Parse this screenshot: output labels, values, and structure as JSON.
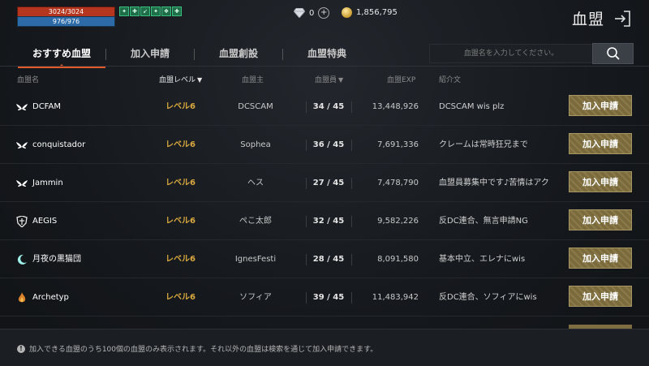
{
  "status": {
    "hp_text": "3024/3024",
    "mp_text": "976/976",
    "hp_fill": 1.0,
    "mp_fill": 1.0,
    "buff_icons": [
      "buff-icon",
      "buff-icon",
      "buff-icon",
      "buff-icon",
      "buff-icon",
      "buff-icon"
    ]
  },
  "currency": {
    "diamonds": "0",
    "gold": "1,856,795"
  },
  "header": {
    "title": "血盟"
  },
  "tabs": [
    {
      "label": "おすすめ血盟",
      "active": true
    },
    {
      "label": "加入申請",
      "active": false
    },
    {
      "label": "血盟創設",
      "active": false
    },
    {
      "label": "血盟特典",
      "active": false
    }
  ],
  "search": {
    "placeholder": "血盟名を入力してください。"
  },
  "columns": {
    "name": "血盟名",
    "level": "血盟レベル",
    "master": "血盟主",
    "members": "血盟員",
    "exp": "血盟EXP",
    "intro": "紹介文"
  },
  "clans": [
    {
      "emblem": "wings-emblem-icon",
      "name": "DCFAM",
      "level": "レベル6",
      "master": "DCSCAM",
      "members": "34 / 45",
      "exp": "13,448,926",
      "intro": "DCSCAM wis plz",
      "join": "加入申請"
    },
    {
      "emblem": "wings-emblem-icon",
      "name": "conquistador",
      "level": "レベル6",
      "master": "Sophea",
      "members": "36 / 45",
      "exp": "7,691,336",
      "intro": "クレームは常時狂兄まで",
      "join": "加入申請"
    },
    {
      "emblem": "wings-emblem-icon",
      "name": "Jammin",
      "level": "レベル6",
      "master": "ヘス",
      "members": "27 / 45",
      "exp": "7,478,790",
      "intro": "血盟員募集中です♪苦情はアク",
      "join": "加入申請"
    },
    {
      "emblem": "shield-emblem-icon",
      "name": "AEGIS",
      "level": "レベル6",
      "master": "ぺこ太郎",
      "members": "32 / 45",
      "exp": "9,582,226",
      "intro": "反DC連合、無言申請NG",
      "join": "加入申請"
    },
    {
      "emblem": "crescent-emblem-icon",
      "name": "月夜の黒猫団",
      "level": "レベル6",
      "master": "IgnesFesti",
      "members": "28 / 45",
      "exp": "8,091,580",
      "intro": "基本中立、エレナにwis",
      "join": "加入申請"
    },
    {
      "emblem": "flame-emblem-icon",
      "name": "Archetyp",
      "level": "レベル6",
      "master": "ソフィア",
      "members": "39 / 45",
      "exp": "11,483,942",
      "intro": "反DC連合、ソフィアにwis",
      "join": "加入申請"
    }
  ],
  "footer": {
    "notice": "加入できる血盟のうち100個の血盟のみ表示されます。それ以外の血盟は検索を通じて加入申請できます。"
  }
}
